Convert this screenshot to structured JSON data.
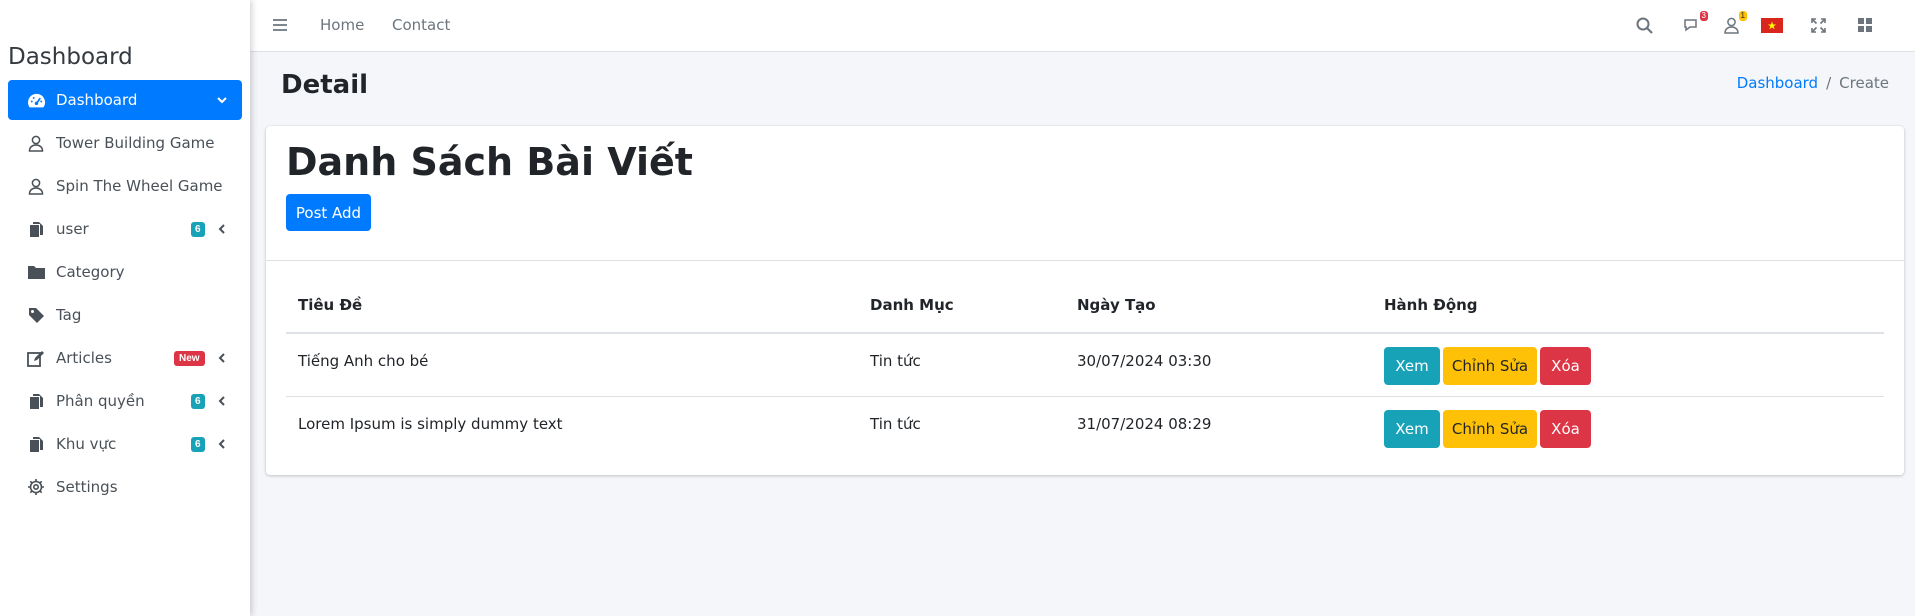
{
  "sidebar": {
    "brand": "Dashboard",
    "items": [
      {
        "label": "Dashboard",
        "icon": "tachometer-icon",
        "active": true,
        "chevron": "down"
      },
      {
        "label": "Tower Building Game",
        "icon": "user-icon"
      },
      {
        "label": "Spin The Wheel Game",
        "icon": "user-icon"
      },
      {
        "label": "user",
        "icon": "copy-icon",
        "badge": "6",
        "chevron": "left"
      },
      {
        "label": "Category",
        "icon": "folder-icon"
      },
      {
        "label": "Tag",
        "icon": "tag-icon"
      },
      {
        "label": "Articles",
        "icon": "edit-icon",
        "badge": "New",
        "chevron": "left"
      },
      {
        "label": "Phân quyền",
        "icon": "copy-icon",
        "badge": "6",
        "chevron": "left"
      },
      {
        "label": "Khu vực",
        "icon": "copy-icon",
        "badge": "6",
        "chevron": "left"
      },
      {
        "label": "Settings",
        "icon": "gear-icon"
      }
    ]
  },
  "navbar": {
    "links": [
      "Home",
      "Contact"
    ],
    "messages_badge": "3",
    "notifications_badge": "1"
  },
  "content": {
    "title": "Detail",
    "breadcrumb": {
      "home": "Dashboard",
      "current": "Create"
    }
  },
  "card": {
    "title": "Danh Sách Bài Viết",
    "add_button": "Post Add",
    "columns": [
      "Tiêu Đề",
      "Danh Mục",
      "Ngày Tạo",
      "Hành Động"
    ],
    "rows": [
      {
        "title": "Tiếng Anh cho bé",
        "category": "Tin tức",
        "created": "30/07/2024 03:30"
      },
      {
        "title": "Lorem Ipsum is simply dummy text",
        "category": "Tin tức",
        "created": "31/07/2024 08:29"
      }
    ],
    "actions": {
      "view": "Xem",
      "edit": "Chỉnh Sửa",
      "delete": "Xóa"
    }
  },
  "colors": {
    "primary": "#007bff",
    "info": "#17a2b8",
    "warning": "#ffc107",
    "danger": "#dc3545"
  }
}
